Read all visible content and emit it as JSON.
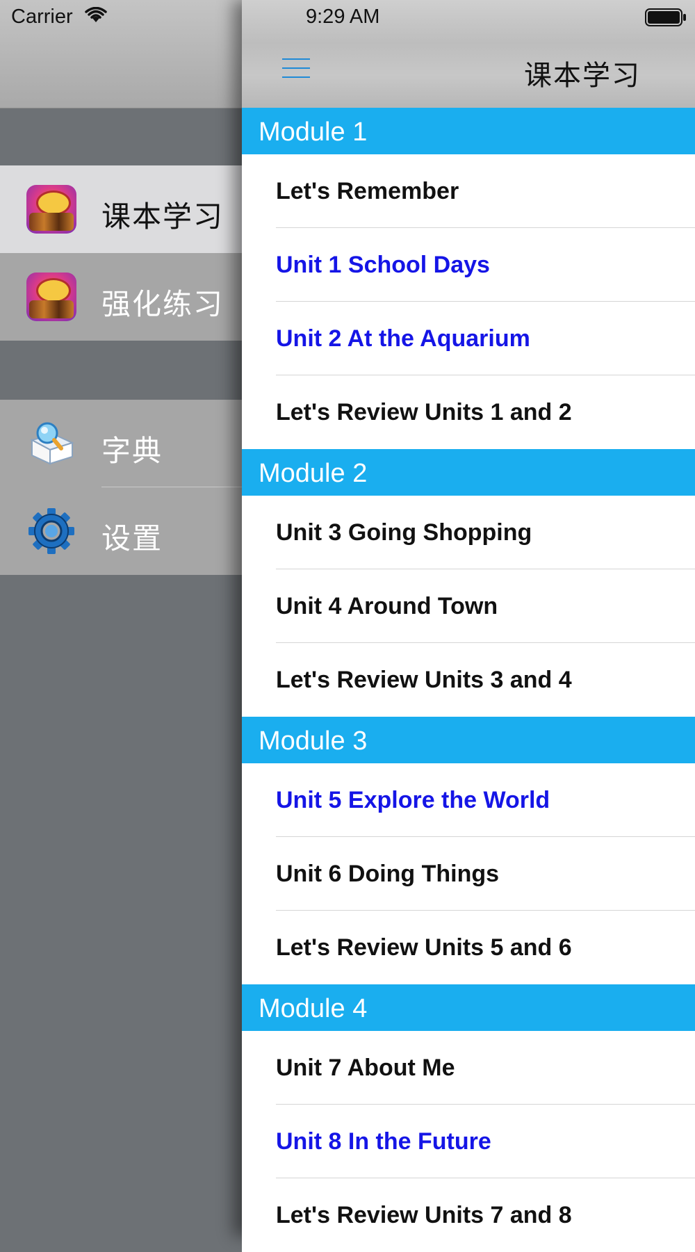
{
  "status_bar": {
    "carrier": "Carrier",
    "time": "9:29 AM"
  },
  "side_menu": {
    "group1": [
      {
        "label": "课本学习",
        "icon": "app-icon",
        "active": true
      },
      {
        "label": "强化练习",
        "icon": "app-icon",
        "active": false
      }
    ],
    "group2": [
      {
        "label": "字典",
        "icon": "dictionary-icon"
      },
      {
        "label": "设置",
        "icon": "gear-icon"
      }
    ]
  },
  "nav": {
    "title": "课本学习",
    "menu_icon": "hamburger-menu-icon"
  },
  "colors": {
    "section_header": "#1aaeef",
    "link_text": "#1515e6",
    "menu_icon": "#1f8ad6"
  },
  "modules": [
    {
      "title": "Module 1",
      "items": [
        {
          "label": "Let's Remember",
          "highlighted": false
        },
        {
          "label": "Unit 1 School Days",
          "highlighted": true
        },
        {
          "label": "Unit 2 At the Aquarium",
          "highlighted": true
        },
        {
          "label": "Let's Review Units 1 and 2",
          "highlighted": false
        }
      ]
    },
    {
      "title": "Module 2",
      "items": [
        {
          "label": "Unit 3 Going Shopping",
          "highlighted": false
        },
        {
          "label": "Unit 4 Around Town",
          "highlighted": false
        },
        {
          "label": "Let's Review Units 3 and 4",
          "highlighted": false
        }
      ]
    },
    {
      "title": "Module 3",
      "items": [
        {
          "label": "Unit 5 Explore the World",
          "highlighted": true
        },
        {
          "label": "Unit 6 Doing Things",
          "highlighted": false
        },
        {
          "label": "Let's Review Units 5 and 6",
          "highlighted": false
        }
      ]
    },
    {
      "title": "Module 4",
      "items": [
        {
          "label": "Unit 7 About Me",
          "highlighted": false
        },
        {
          "label": "Unit 8 In the Future",
          "highlighted": true
        },
        {
          "label": "Let's Review Units 7 and 8",
          "highlighted": false
        }
      ]
    }
  ]
}
